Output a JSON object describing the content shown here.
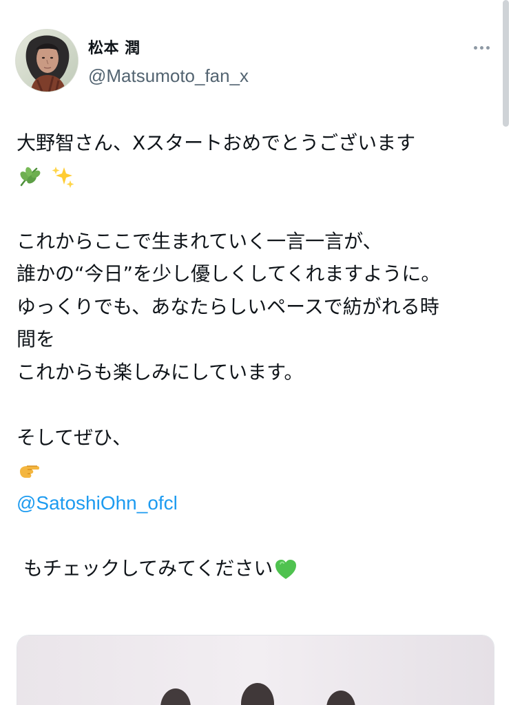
{
  "tweet": {
    "display_name": "松本 潤",
    "handle": "@Matsumoto_fan_x",
    "text_line_1": "大野智さん、Xスタートおめでとうございます",
    "emoji_1": "herb-icon",
    "emoji_2": "sparkles-icon",
    "text_line_3": "これからここで生まれていく一言一言が、",
    "text_line_4": "誰かの“今日”を少し優しくしてくれますように。",
    "text_line_5": "ゆっくりでも、あなたらしいペースで紡がれる時",
    "text_line_6": "間を",
    "text_line_7": "これからも楽しみにしています。",
    "text_line_8": "そしてぜひ、",
    "pointing_emoji": "pointing-right-icon",
    "mention": "@SatoshiOhn_ofcl",
    "text_line_10": "もチェックしてみてください",
    "heart_emoji": "green-heart-icon"
  },
  "menu": {
    "more_icon": "more-options-icon"
  },
  "media": {
    "image_type": "photo"
  },
  "colors": {
    "text": "#0f1419",
    "secondary": "#536471",
    "mention": "#1d9bf0",
    "background": "#ffffff"
  }
}
